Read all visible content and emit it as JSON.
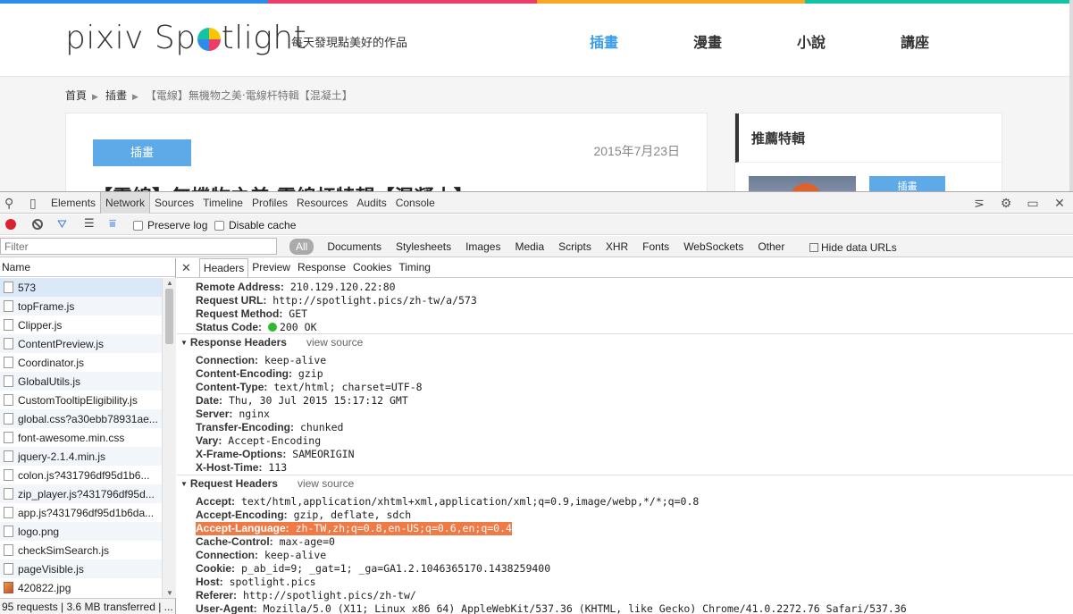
{
  "site": {
    "logo_text_pre": "pixiv Sp",
    "logo_text_post": "tlight",
    "tagline": "每天發現點美好的作品",
    "nav": [
      "插畫",
      "漫畫",
      "小說",
      "講座"
    ],
    "breadcrumb": [
      "首頁",
      "插畫",
      "【電線】無機物之美‧電線杆特輯【混凝土】"
    ],
    "article": {
      "tag": "插畫",
      "date": "2015年7月23日",
      "title": "【電線】無機物之美‧電線杆特輯【混凝土】"
    },
    "aside": {
      "heading": "推薦特輯",
      "tag": "插畫"
    },
    "colors": {
      "accent": "#3d9ee8",
      "rainbow": [
        "#2d8ce8",
        "#ef3b6a",
        "#f7a825",
        "#14c3a2"
      ]
    }
  },
  "devtools": {
    "tabs": [
      "Elements",
      "Network",
      "Sources",
      "Timeline",
      "Profiles",
      "Resources",
      "Audits",
      "Console"
    ],
    "selected_tab": "Network",
    "toolbar": {
      "preserve_log": "Preserve log",
      "disable_cache": "Disable cache"
    },
    "filter": {
      "placeholder": "Filter",
      "all": "All",
      "types": [
        "Documents",
        "Stylesheets",
        "Images",
        "Media",
        "Scripts",
        "XHR",
        "Fonts",
        "WebSockets",
        "Other"
      ],
      "hide_data_urls": "Hide data URLs"
    },
    "request_list": {
      "header": "Name",
      "rows": [
        {
          "name": "573",
          "icon": "doc"
        },
        {
          "name": "topFrame.js",
          "icon": "doc"
        },
        {
          "name": "Clipper.js",
          "icon": "doc"
        },
        {
          "name": "ContentPreview.js",
          "icon": "doc"
        },
        {
          "name": "Coordinator.js",
          "icon": "doc"
        },
        {
          "name": "GlobalUtils.js",
          "icon": "doc"
        },
        {
          "name": "CustomTooltipEligibility.js",
          "icon": "doc"
        },
        {
          "name": "global.css?a30ebb78931ae...",
          "icon": "doc"
        },
        {
          "name": "font-awesome.min.css",
          "icon": "doc"
        },
        {
          "name": "jquery-2.1.4.min.js",
          "icon": "doc"
        },
        {
          "name": "colon.js?431796df95d1b6...",
          "icon": "doc"
        },
        {
          "name": "zip_player.js?431796df95d...",
          "icon": "doc"
        },
        {
          "name": "app.js?431796df95d1b6da...",
          "icon": "doc"
        },
        {
          "name": "logo.png",
          "icon": "doc"
        },
        {
          "name": "checkSimSearch.js",
          "icon": "doc"
        },
        {
          "name": "pageVisible.js",
          "icon": "doc"
        },
        {
          "name": "420822.jpg",
          "icon": "img"
        }
      ],
      "status": "95 requests | 3.6 MB transferred | ..."
    },
    "details": {
      "tabs": [
        "Headers",
        "Preview",
        "Response",
        "Cookies",
        "Timing"
      ],
      "selected_tab": "Headers",
      "general": [
        {
          "k": "Remote Address:",
          "v": "210.129.120.22:80"
        },
        {
          "k": "Request URL:",
          "v": "http://spotlight.pics/zh-tw/a/573"
        },
        {
          "k": "Request Method:",
          "v": "GET"
        },
        {
          "k": "Status Code:",
          "v": "200 OK"
        }
      ],
      "response_headers": {
        "title": "Response Headers",
        "view_source": "view source",
        "items": [
          {
            "k": "Connection:",
            "v": "keep-alive"
          },
          {
            "k": "Content-Encoding:",
            "v": "gzip"
          },
          {
            "k": "Content-Type:",
            "v": "text/html; charset=UTF-8"
          },
          {
            "k": "Date:",
            "v": "Thu, 30 Jul 2015 15:17:12 GMT"
          },
          {
            "k": "Server:",
            "v": "nginx"
          },
          {
            "k": "Transfer-Encoding:",
            "v": "chunked"
          },
          {
            "k": "Vary:",
            "v": "Accept-Encoding"
          },
          {
            "k": "X-Frame-Options:",
            "v": "SAMEORIGIN"
          },
          {
            "k": "X-Host-Time:",
            "v": "113"
          }
        ]
      },
      "request_headers": {
        "title": "Request Headers",
        "view_source": "view source",
        "items": [
          {
            "k": "Accept:",
            "v": "text/html,application/xhtml+xml,application/xml;q=0.9,image/webp,*/*;q=0.8"
          },
          {
            "k": "Accept-Encoding:",
            "v": "gzip, deflate, sdch"
          },
          {
            "k": "Accept-Language:",
            "v": "zh-TW,zh;q=0.8,en-US;q=0.6,en;q=0.4",
            "highlight": true
          },
          {
            "k": "Cache-Control:",
            "v": "max-age=0"
          },
          {
            "k": "Connection:",
            "v": "keep-alive"
          },
          {
            "k": "Cookie:",
            "v": "p_ab_id=9; _gat=1; _ga=GA1.2.1046365170.1438259400"
          },
          {
            "k": "Host:",
            "v": "spotlight.pics"
          },
          {
            "k": "Referer:",
            "v": "http://spotlight.pics/zh-tw/"
          },
          {
            "k": "User-Agent:",
            "v": "Mozilla/5.0 (X11; Linux x86_64) AppleWebKit/537.36 (KHTML, like Gecko) Chrome/41.0.2272.76 Safari/537.36"
          }
        ]
      }
    }
  }
}
